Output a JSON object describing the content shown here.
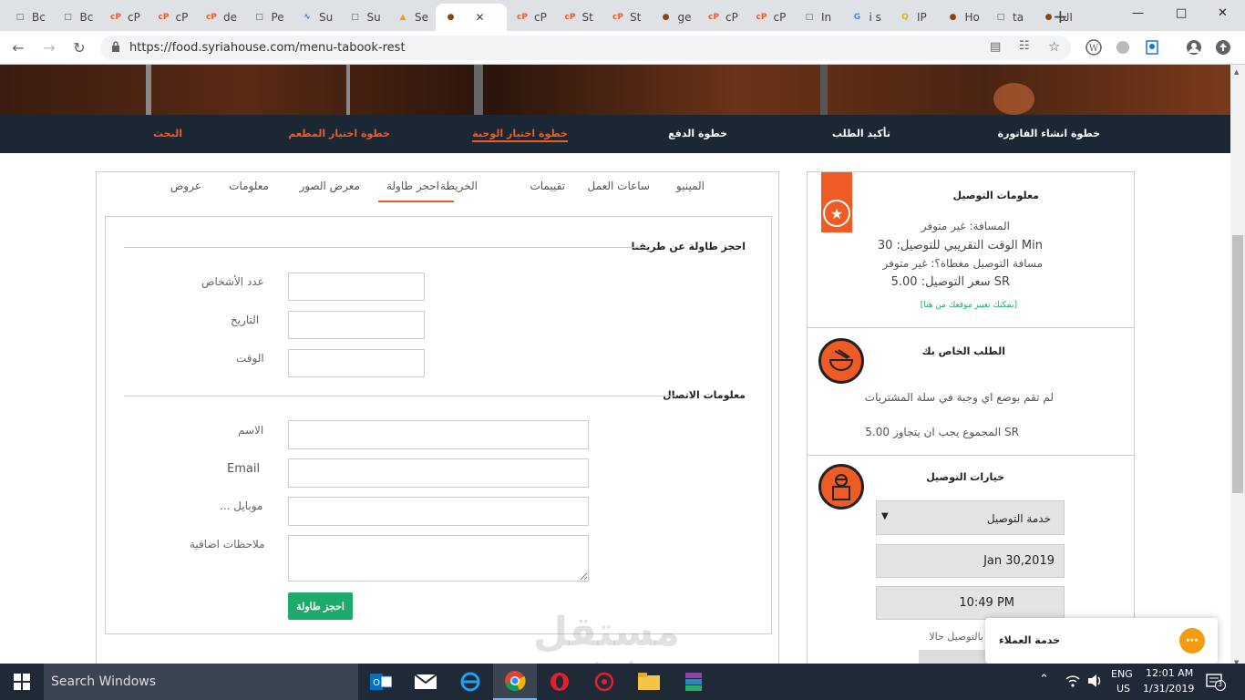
{
  "browser": {
    "tabs": [
      {
        "label": "Bc",
        "icon": "page-icon"
      },
      {
        "label": "Bc",
        "icon": "page-icon"
      },
      {
        "label": "cP",
        "icon": "cpanel-icon"
      },
      {
        "label": "cP",
        "icon": "cpanel-icon"
      },
      {
        "label": "de",
        "icon": "cpanel-icon"
      },
      {
        "label": "Pe",
        "icon": "page-icon"
      },
      {
        "label": "Su",
        "icon": "app-icon"
      },
      {
        "label": "Su",
        "icon": "page-icon"
      },
      {
        "label": "Se",
        "icon": "fire-icon"
      },
      {
        "label": "",
        "icon": "site-icon",
        "active": true
      },
      {
        "label": "cP",
        "icon": "cpanel-icon"
      },
      {
        "label": "St",
        "icon": "cpanel-icon"
      },
      {
        "label": "St",
        "icon": "cpanel-icon"
      },
      {
        "label": "ge",
        "icon": "site-icon"
      },
      {
        "label": "cP",
        "icon": "cpanel-icon"
      },
      {
        "label": "cP",
        "icon": "cpanel-icon"
      },
      {
        "label": "In",
        "icon": "page-icon"
      },
      {
        "label": "i s",
        "icon": "google-icon"
      },
      {
        "label": "IP",
        "icon": "search-icon"
      },
      {
        "label": "Ho",
        "icon": "site-icon"
      },
      {
        "label": "ta",
        "icon": "page-icon"
      },
      {
        "label": "الد",
        "icon": "site-icon"
      }
    ],
    "new_tab": "+",
    "url": "https://food.syriahouse.com/menu-tabook-rest"
  },
  "steps": [
    {
      "label": "خطوة انشاء الفاتورة",
      "color": "white"
    },
    {
      "label": "تأكيد الطلب",
      "color": "white"
    },
    {
      "label": "خطوة الدفع",
      "color": "white"
    },
    {
      "label": "خطوة اختيار الوجبة",
      "color": "orange",
      "underline": true
    },
    {
      "label": "خطوة اختيار المطعم",
      "color": "orange"
    },
    {
      "label": "البحث",
      "color": "orange"
    }
  ],
  "page_tabs": [
    "المينيو",
    "ساعات العمل",
    "تقييمات",
    "الخريطة",
    "احجز طاولة",
    "معرض الصور",
    "معلومات",
    "عروض"
  ],
  "active_page_tab": "احجز طاولة",
  "booking": {
    "section_title": "احجز طاولة عن طريقنا",
    "persons_label": "عدد الأشخاص",
    "date_label": "التاريخ",
    "time_label": "الوقت",
    "contact_title": "معلومات الاتصال",
    "name_label": "الاسم",
    "email_label": "Email",
    "mobile_label": "... موبايل",
    "notes_label": "ملاحظات اضافية",
    "submit_label": "احجز طاولة"
  },
  "delivery_info": {
    "title": "معلومات التوصيل",
    "distance": "المسافة: غير متوفر",
    "eta": "الوقت التقريبي للتوصيل: 30 Min",
    "covered": "مسافة التوصيل مغطاة؟: غير متوفر",
    "price": "سعر التوصيل: 5.00 SR",
    "change_link": "[يمكنك تغيير موقعك من هنا]"
  },
  "your_order": {
    "title": "الطلب الخاص بك",
    "empty": "لم تقم بوضع اي وجبة في سلة المشتريات",
    "minimum": "المجموع يجب ان يتجاوز 5.00 SR"
  },
  "delivery_options": {
    "title": "خيارات التوصيل",
    "service": "خدمة التوصيل",
    "date": "Jan 30,2019",
    "time": "10:49 PM",
    "now_label": "بالتوصيل حالا"
  },
  "chat": {
    "label": "خدمة العملاء"
  },
  "watermark": {
    "arabic": "مستقل",
    "latin": "mostaql.com"
  },
  "taskbar": {
    "search": "Search Windows",
    "lang": "ENG",
    "region": "US",
    "time": "12:01 AM",
    "date": "1/31/2019",
    "notifications": "3"
  },
  "colors": {
    "accent": "#ef5b25",
    "nav_bg": "#1b2733",
    "button": "#1eaa6a",
    "link": "#1eaa6a"
  }
}
